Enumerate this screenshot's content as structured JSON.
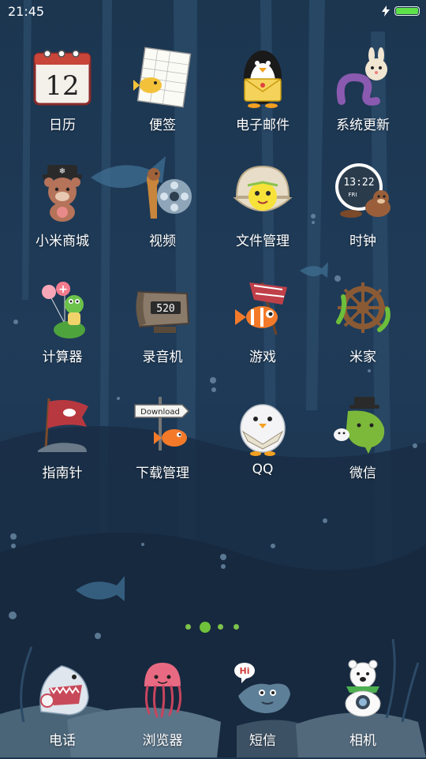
{
  "status_bar": {
    "time": "21:45",
    "battery_level": 1.0,
    "charging": true,
    "battery_color": "#5de04a"
  },
  "home_screen": {
    "apps": [
      {
        "label": "日历",
        "icon": "calendar-icon",
        "date_digit": "12"
      },
      {
        "label": "便签",
        "icon": "notes-icon"
      },
      {
        "label": "电子邮件",
        "icon": "email-icon"
      },
      {
        "label": "系统更新",
        "icon": "system-update-icon"
      },
      {
        "label": "小米商城",
        "icon": "mi-store-icon"
      },
      {
        "label": "视频",
        "icon": "video-icon"
      },
      {
        "label": "文件管理",
        "icon": "file-manager-icon"
      },
      {
        "label": "时钟",
        "icon": "clock-icon",
        "clock_time": "13:22",
        "clock_day": "FRI"
      },
      {
        "label": "计算器",
        "icon": "calculator-icon"
      },
      {
        "label": "录音机",
        "icon": "recorder-icon",
        "counter": "520"
      },
      {
        "label": "游戏",
        "icon": "game-icon"
      },
      {
        "label": "米家",
        "icon": "mijia-icon"
      },
      {
        "label": "指南针",
        "icon": "compass-icon"
      },
      {
        "label": "下载管理",
        "icon": "download-manager-icon",
        "sign_text": "Download"
      },
      {
        "label": "QQ",
        "icon": "qq-icon"
      },
      {
        "label": "微信",
        "icon": "wechat-icon"
      }
    ]
  },
  "page_indicator": {
    "pages": 4,
    "current": 2,
    "color": "#6fc23a"
  },
  "dock": {
    "apps": [
      {
        "label": "电话",
        "icon": "phone-icon"
      },
      {
        "label": "浏览器",
        "icon": "browser-icon"
      },
      {
        "label": "短信",
        "icon": "messages-icon",
        "bubble_text": "Hi"
      },
      {
        "label": "相机",
        "icon": "camera-icon"
      }
    ]
  }
}
